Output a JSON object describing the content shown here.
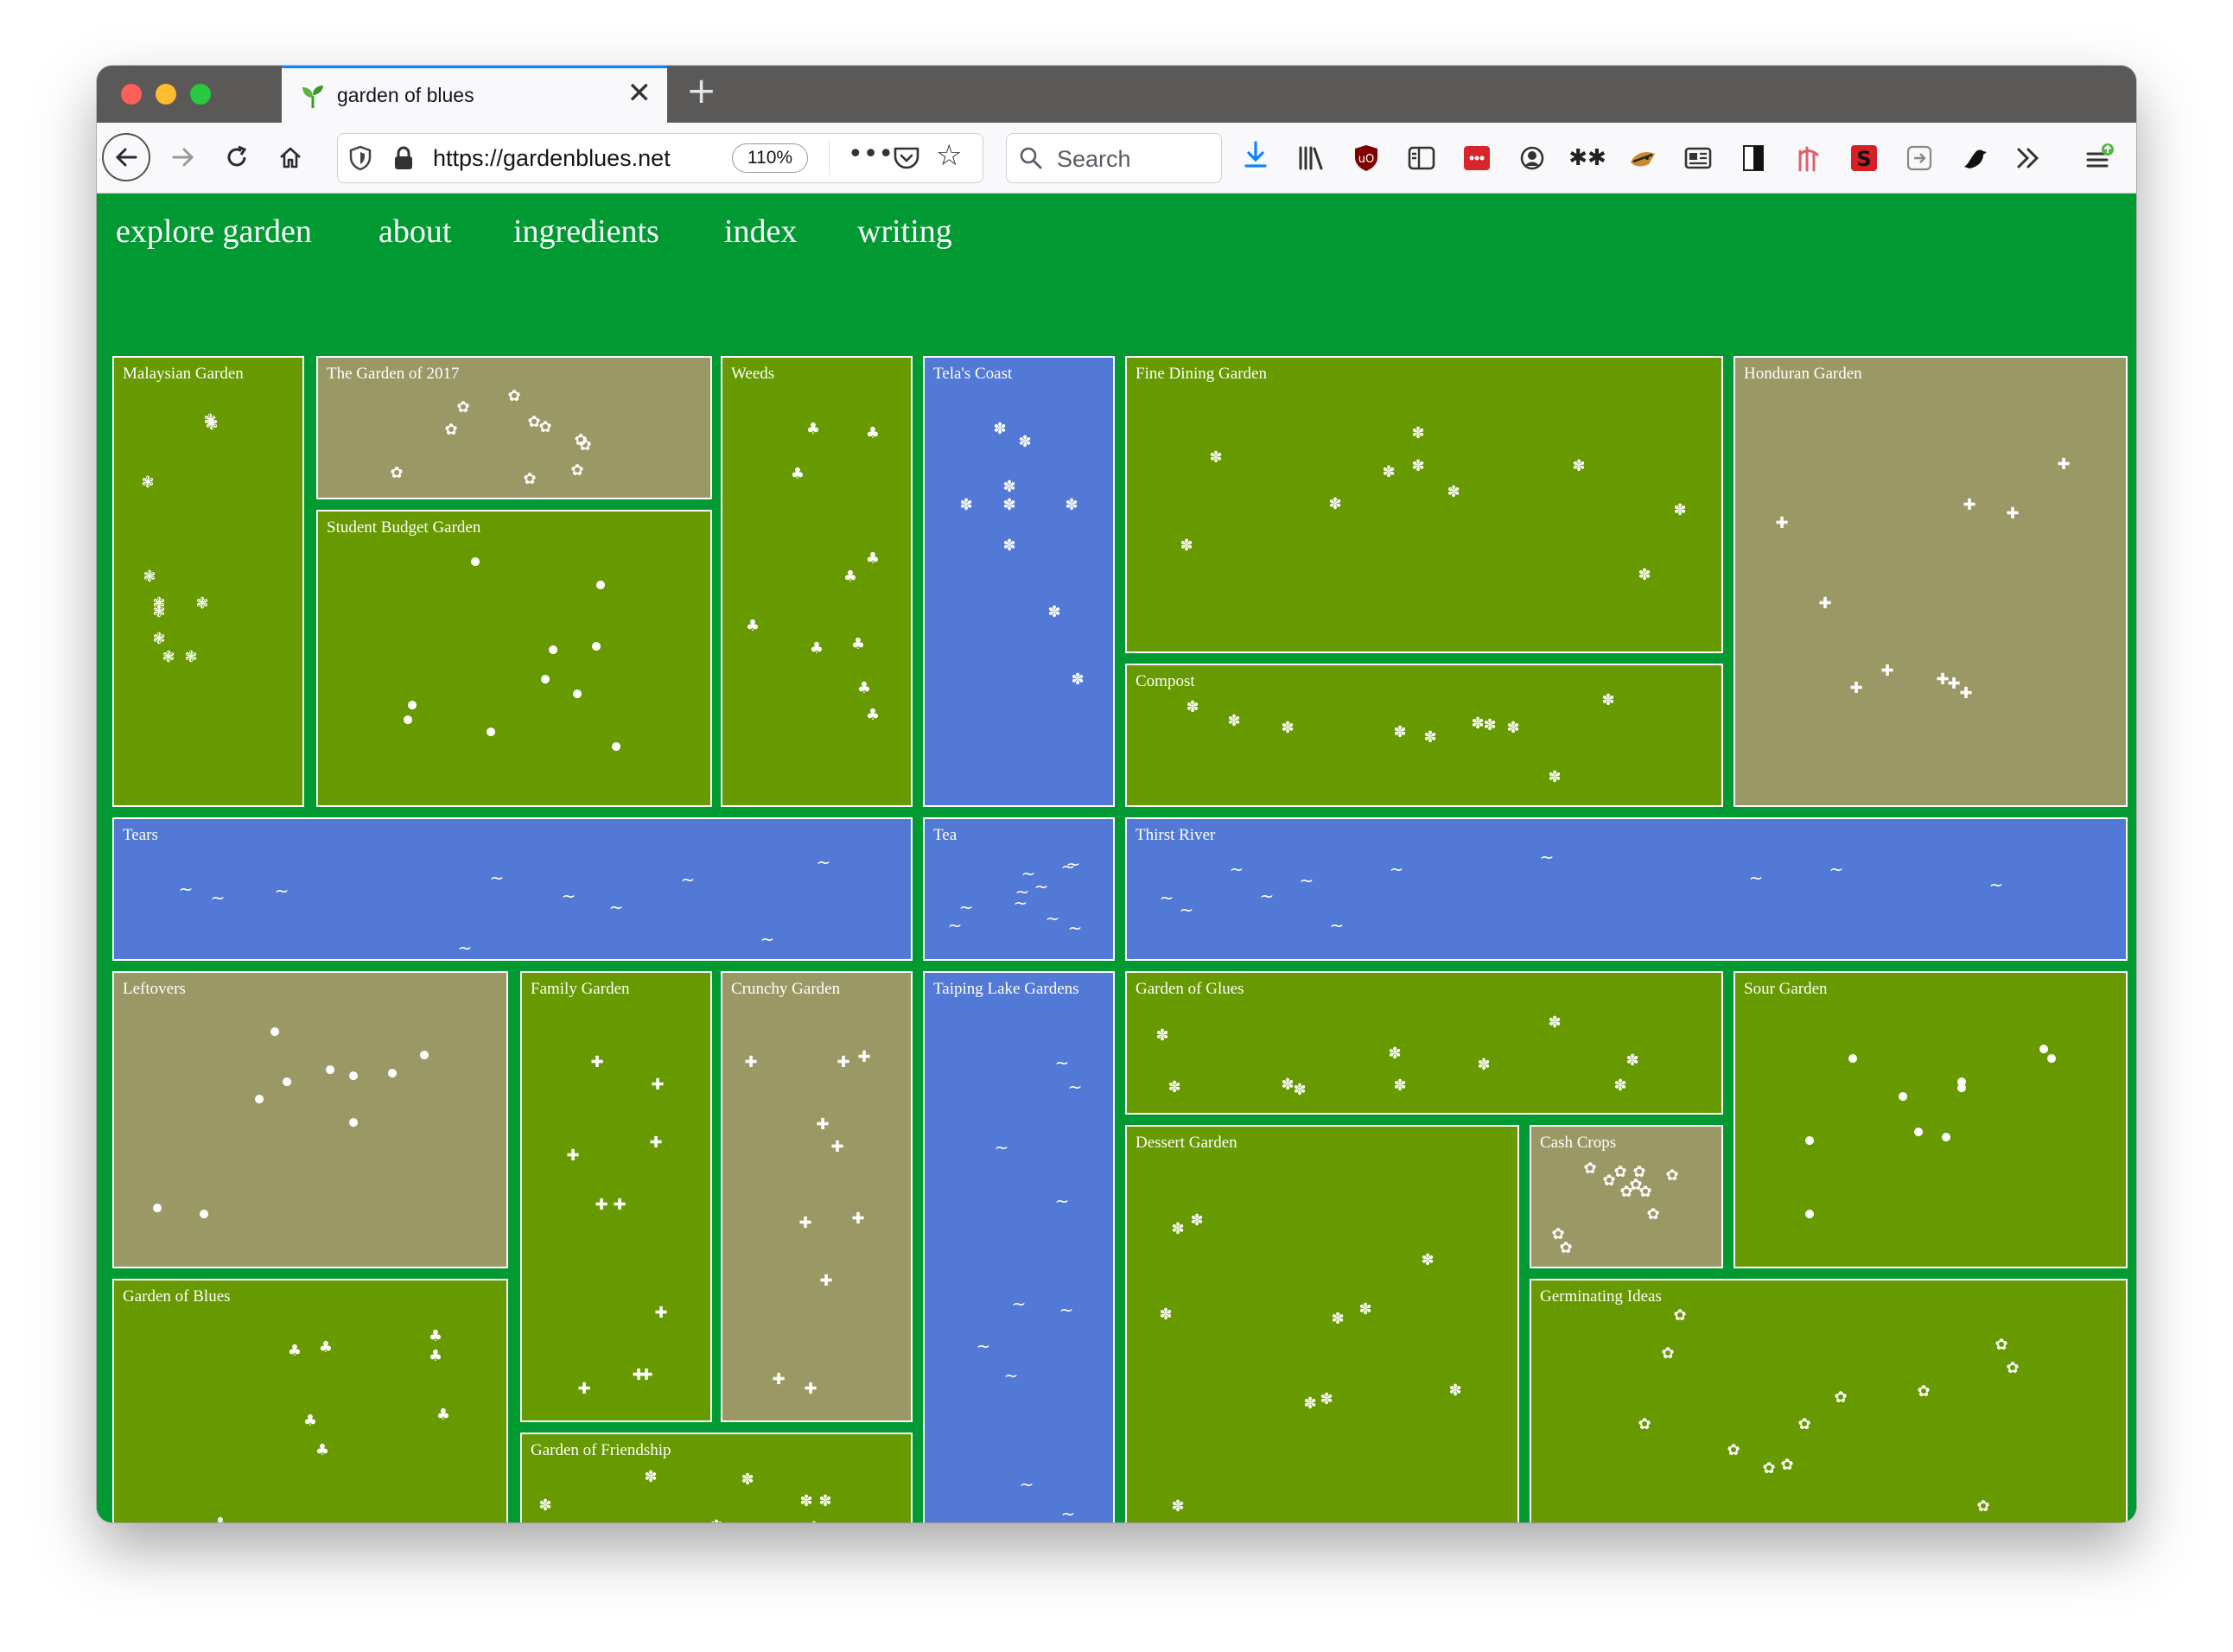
{
  "browser": {
    "tab_title": "garden of blues",
    "tab_close": "✕",
    "new_tab": "+",
    "url": "https://gardenblues.net",
    "zoom": "110%",
    "more": "•••",
    "search_placeholder": "Search",
    "toolbar_icons": [
      "download-icon",
      "library-icon",
      "ublock-icon",
      "reader-icon",
      "extension-red-icon",
      "account-icon",
      "extension-dots-icon",
      "extension-fox-icon",
      "news-icon",
      "contrast-icon",
      "extension-pink-icon",
      "extension-s-icon",
      "extension-arrow-icon",
      "extension-bird-icon",
      "overflow-icon",
      "menu-icon"
    ]
  },
  "site": {
    "nav": [
      "explore garden",
      "about",
      "ingredients",
      "index",
      "writing"
    ],
    "colors": {
      "background": "#009932",
      "green": "#669a00",
      "khaki": "#9a9966",
      "blue": "#5379d6"
    },
    "gardens": [
      {
        "name": "Malaysian Garden",
        "color": "green",
        "glyph": "❃"
      },
      {
        "name": "The Garden of 2017",
        "color": "khaki",
        "glyph": "✿"
      },
      {
        "name": "Student Budget Garden",
        "color": "green",
        "glyph": "●"
      },
      {
        "name": "Weeds",
        "color": "green",
        "glyph": "♣"
      },
      {
        "name": "Tela's Coast",
        "color": "blue",
        "glyph": "✽"
      },
      {
        "name": "Fine Dining Garden",
        "color": "green",
        "glyph": "✽"
      },
      {
        "name": "Compost",
        "color": "green",
        "glyph": "✽"
      },
      {
        "name": "Honduran Garden",
        "color": "khaki",
        "glyph": "✚"
      },
      {
        "name": "Tears",
        "color": "blue",
        "glyph": "~"
      },
      {
        "name": "Tea",
        "color": "blue",
        "glyph": "~"
      },
      {
        "name": "Thirst River",
        "color": "blue",
        "glyph": "~"
      },
      {
        "name": "Leftovers",
        "color": "khaki",
        "glyph": "●"
      },
      {
        "name": "Family Garden",
        "color": "green",
        "glyph": "✚"
      },
      {
        "name": "Crunchy Garden",
        "color": "khaki",
        "glyph": "✚"
      },
      {
        "name": "Taiping Lake Gardens",
        "color": "blue",
        "glyph": "~"
      },
      {
        "name": "Garden of Glues",
        "color": "green",
        "glyph": "✽"
      },
      {
        "name": "Sour Garden",
        "color": "green",
        "glyph": "●"
      },
      {
        "name": "Dessert Garden",
        "color": "green",
        "glyph": "✽"
      },
      {
        "name": "Cash Crops",
        "color": "khaki",
        "glyph": "✿"
      },
      {
        "name": "Garden of Blues",
        "color": "green",
        "glyph": "♣"
      },
      {
        "name": "Germinating Ideas",
        "color": "green",
        "glyph": "✿"
      },
      {
        "name": "Garden of Friendship",
        "color": "green",
        "glyph": "✽"
      }
    ]
  }
}
